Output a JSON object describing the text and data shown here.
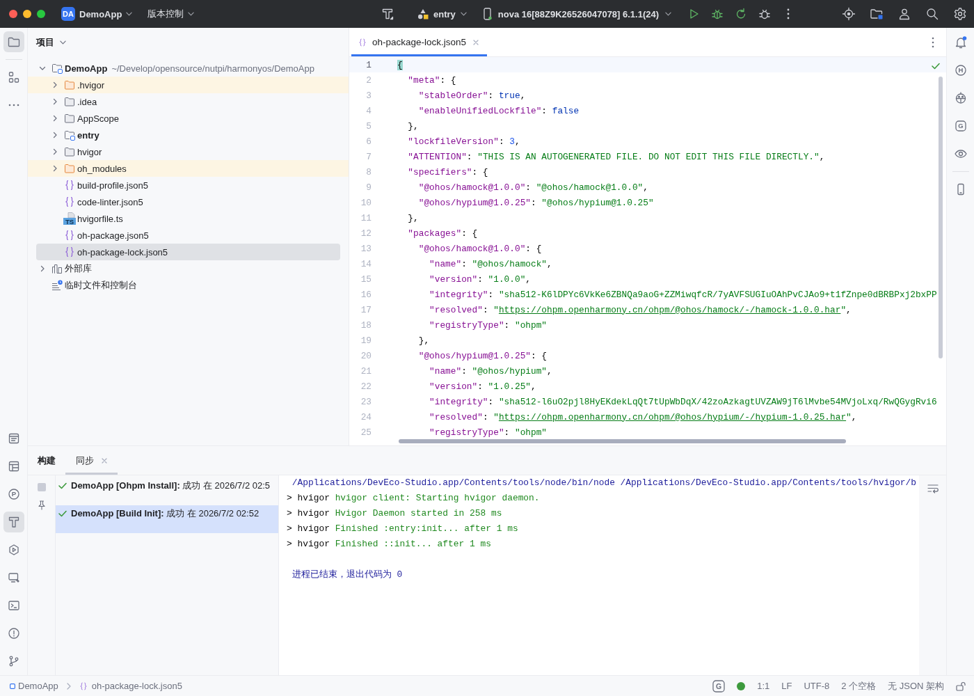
{
  "title_bar": {
    "project_badge": "DA",
    "project": "DemoApp",
    "vcs": "版本控制",
    "run_config": "entry",
    "device": "nova 16[88Z9K26526047078] 6.1.1(24)"
  },
  "left_toolbar": {
    "top": [
      {
        "selected": true
      },
      {
        "selected": false
      },
      {
        "selected": false
      }
    ],
    "bottom": [
      {
        "selected": false
      },
      {
        "selected": false
      },
      {
        "selected": false,
        "letter": "P"
      },
      {
        "selected": true
      },
      {
        "selected": false
      },
      {
        "selected": false
      },
      {
        "selected": false
      },
      {
        "selected": false
      },
      {
        "selected": false
      }
    ]
  },
  "project": {
    "title": "项目",
    "tree": [
      {
        "name": "DemoApp",
        "kind": "module",
        "path": "~/Develop/opensource/nutpi/harmonyos/DemoApp",
        "expanded": true,
        "selected": false,
        "children": [
          {
            "name": ".hvigor",
            "kind": "folder",
            "excluded": true,
            "expanded": false,
            "selected": false
          },
          {
            "name": ".idea",
            "kind": "folder",
            "excluded": false,
            "expanded": false,
            "selected": false
          },
          {
            "name": "AppScope",
            "kind": "folder",
            "excluded": false,
            "expanded": false,
            "selected": false
          },
          {
            "name": "entry",
            "kind": "module",
            "expanded": false,
            "selected": false
          },
          {
            "name": "hvigor",
            "kind": "folder",
            "excluded": false,
            "expanded": false,
            "selected": false
          },
          {
            "name": "oh_modules",
            "kind": "folder",
            "excluded": true,
            "expanded": false,
            "selected": false
          },
          {
            "name": "build-profile.json5",
            "kind": "json",
            "selected": false
          },
          {
            "name": "code-linter.json5",
            "kind": "json",
            "selected": false
          },
          {
            "name": "hvigorfile.ts",
            "kind": "ts",
            "icon_text": "TS",
            "selected": false
          },
          {
            "name": "oh-package.json5",
            "kind": "json",
            "selected": false
          },
          {
            "name": "oh-package-lock.json5",
            "kind": "json",
            "selected": true
          }
        ]
      },
      {
        "name": "外部库",
        "kind": "libraries",
        "expanded": false,
        "selected": false
      },
      {
        "name": "临时文件和控制台",
        "kind": "scratches",
        "selected": false
      }
    ]
  },
  "editor": {
    "tabs": [
      {
        "label": "oh-package-lock.json5",
        "selected": true
      }
    ],
    "lines": [
      {
        "number": "1",
        "current": true,
        "tokens": [
          {
            "kind": "match",
            "text": "{"
          }
        ]
      },
      {
        "number": "2",
        "current": false,
        "tokens": [
          {
            "kind": "key",
            "text": "  \"meta\""
          },
          {
            "kind": "punct",
            "text": ": {"
          }
        ]
      },
      {
        "number": "3",
        "current": false,
        "tokens": [
          {
            "kind": "key",
            "text": "    \"stableOrder\""
          },
          {
            "kind": "punct",
            "text": ": "
          },
          {
            "kind": "keyword",
            "text": "true"
          },
          {
            "kind": "punct",
            "text": ","
          }
        ]
      },
      {
        "number": "4",
        "current": false,
        "tokens": [
          {
            "kind": "key",
            "text": "    \"enableUnifiedLockfile\""
          },
          {
            "kind": "punct",
            "text": ": "
          },
          {
            "kind": "keyword",
            "text": "false"
          }
        ]
      },
      {
        "number": "5",
        "current": false,
        "tokens": [
          {
            "kind": "punct",
            "text": "  },"
          }
        ]
      },
      {
        "number": "6",
        "current": false,
        "tokens": [
          {
            "kind": "key",
            "text": "  \"lockfileVersion\""
          },
          {
            "kind": "punct",
            "text": ": "
          },
          {
            "kind": "number",
            "text": "3"
          },
          {
            "kind": "punct",
            "text": ","
          }
        ]
      },
      {
        "number": "7",
        "current": false,
        "tokens": [
          {
            "kind": "key",
            "text": "  \"ATTENTION\""
          },
          {
            "kind": "punct",
            "text": ": "
          },
          {
            "kind": "string",
            "text": "\"THIS IS AN AUTOGENERATED FILE. DO NOT EDIT THIS FILE DIRECTLY.\""
          },
          {
            "kind": "punct",
            "text": ","
          }
        ]
      },
      {
        "number": "8",
        "current": false,
        "tokens": [
          {
            "kind": "key",
            "text": "  \"specifiers\""
          },
          {
            "kind": "punct",
            "text": ": {"
          }
        ]
      },
      {
        "number": "9",
        "current": false,
        "tokens": [
          {
            "kind": "key",
            "text": "    \"@ohos/hamock@1.0.0\""
          },
          {
            "kind": "punct",
            "text": ": "
          },
          {
            "kind": "string",
            "text": "\"@ohos/hamock@1.0.0\""
          },
          {
            "kind": "punct",
            "text": ","
          }
        ]
      },
      {
        "number": "10",
        "current": false,
        "tokens": [
          {
            "kind": "key",
            "text": "    \"@ohos/hypium@1.0.25\""
          },
          {
            "kind": "punct",
            "text": ": "
          },
          {
            "kind": "string",
            "text": "\"@ohos/hypium@1.0.25\""
          }
        ]
      },
      {
        "number": "11",
        "current": false,
        "tokens": [
          {
            "kind": "punct",
            "text": "  },"
          }
        ]
      },
      {
        "number": "12",
        "current": false,
        "tokens": [
          {
            "kind": "key",
            "text": "  \"packages\""
          },
          {
            "kind": "punct",
            "text": ": {"
          }
        ]
      },
      {
        "number": "13",
        "current": false,
        "tokens": [
          {
            "kind": "key",
            "text": "    \"@ohos/hamock@1.0.0\""
          },
          {
            "kind": "punct",
            "text": ": {"
          }
        ]
      },
      {
        "number": "14",
        "current": false,
        "tokens": [
          {
            "kind": "key",
            "text": "      \"name\""
          },
          {
            "kind": "punct",
            "text": ": "
          },
          {
            "kind": "string",
            "text": "\"@ohos/hamock\""
          },
          {
            "kind": "punct",
            "text": ","
          }
        ]
      },
      {
        "number": "15",
        "current": false,
        "tokens": [
          {
            "kind": "key",
            "text": "      \"version\""
          },
          {
            "kind": "punct",
            "text": ": "
          },
          {
            "kind": "string",
            "text": "\"1.0.0\""
          },
          {
            "kind": "punct",
            "text": ","
          }
        ]
      },
      {
        "number": "16",
        "current": false,
        "tokens": [
          {
            "kind": "key",
            "text": "      \"integrity\""
          },
          {
            "kind": "punct",
            "text": ": "
          },
          {
            "kind": "string",
            "text": "\"sha512-K6lDPYc6VkKe6ZBNQa9aoG+ZZMiwqfcR/7yAVFSUGIuOAhPvCJAo9+t1fZnpe0dBRBPxj2bxPP"
          }
        ]
      },
      {
        "number": "17",
        "current": false,
        "tokens": [
          {
            "kind": "key",
            "text": "      \"resolved\""
          },
          {
            "kind": "punct",
            "text": ": "
          },
          {
            "kind": "string",
            "text": "\""
          },
          {
            "kind": "link",
            "text": "https://ohpm.openharmony.cn/ohpm/@ohos/hamock/-/hamock-1.0.0.har"
          },
          {
            "kind": "string",
            "text": "\""
          },
          {
            "kind": "punct",
            "text": ","
          }
        ]
      },
      {
        "number": "18",
        "current": false,
        "tokens": [
          {
            "kind": "key",
            "text": "      \"registryType\""
          },
          {
            "kind": "punct",
            "text": ": "
          },
          {
            "kind": "string",
            "text": "\"ohpm\""
          }
        ]
      },
      {
        "number": "19",
        "current": false,
        "tokens": [
          {
            "kind": "punct",
            "text": "    },"
          }
        ]
      },
      {
        "number": "20",
        "current": false,
        "tokens": [
          {
            "kind": "key",
            "text": "    \"@ohos/hypium@1.0.25\""
          },
          {
            "kind": "punct",
            "text": ": {"
          }
        ]
      },
      {
        "number": "21",
        "current": false,
        "tokens": [
          {
            "kind": "key",
            "text": "      \"name\""
          },
          {
            "kind": "punct",
            "text": ": "
          },
          {
            "kind": "string",
            "text": "\"@ohos/hypium\""
          },
          {
            "kind": "punct",
            "text": ","
          }
        ]
      },
      {
        "number": "22",
        "current": false,
        "tokens": [
          {
            "kind": "key",
            "text": "      \"version\""
          },
          {
            "kind": "punct",
            "text": ": "
          },
          {
            "kind": "string",
            "text": "\"1.0.25\""
          },
          {
            "kind": "punct",
            "text": ","
          }
        ]
      },
      {
        "number": "23",
        "current": false,
        "tokens": [
          {
            "kind": "key",
            "text": "      \"integrity\""
          },
          {
            "kind": "punct",
            "text": ": "
          },
          {
            "kind": "string",
            "text": "\"sha512-l6uO2pjl8HyEKdekLqQt7tUpWbDqX/42zoAzkagtUVZAW9jT6lMvbe54MVjoLxq/RwQGygRvi6"
          }
        ]
      },
      {
        "number": "24",
        "current": false,
        "tokens": [
          {
            "kind": "key",
            "text": "      \"resolved\""
          },
          {
            "kind": "punct",
            "text": ": "
          },
          {
            "kind": "string",
            "text": "\""
          },
          {
            "kind": "link",
            "text": "https://ohpm.openharmony.cn/ohpm/@ohos/hypium/-/hypium-1.0.25.har"
          },
          {
            "kind": "string",
            "text": "\""
          },
          {
            "kind": "punct",
            "text": ","
          }
        ]
      },
      {
        "number": "25",
        "current": false,
        "tokens": [
          {
            "kind": "key",
            "text": "      \"registryType\""
          },
          {
            "kind": "punct",
            "text": ": "
          },
          {
            "kind": "string",
            "text": "\"ohpm\""
          }
        ]
      }
    ]
  },
  "right_toolbar": {
    "notification_unread": true,
    "letters": [
      "H",
      "G"
    ]
  },
  "build_panel": {
    "title": "构建",
    "tabs": [
      {
        "label": "同步",
        "selected": true
      }
    ],
    "tasks": [
      {
        "success": true,
        "text": "**DemoApp [Ohpm Install]:** 成功 在 2026/7/2 02:5",
        "selected": false
      },
      {
        "success": true,
        "text": "**DemoApp [Build Init]:** 成功 在 2026/7/2 02:52",
        "selected": true
      }
    ],
    "console": [
      {
        "kind": "command",
        "text": "/Applications/DevEco-Studio.app/Contents/tools/node/bin/node /Applications/DevEco-Studio.app/Contents/tools/hvigor/b"
      },
      {
        "kind": "log",
        "prefix": "> hvigor",
        "text": "hvigor client: Starting hvigor daemon."
      },
      {
        "kind": "log",
        "prefix": "> hvigor",
        "text": "Hvigor Daemon started in 258 ms"
      },
      {
        "kind": "log",
        "prefix": "> hvigor",
        "text": "Finished :entry:init... after 1 ms"
      },
      {
        "kind": "log",
        "prefix": "> hvigor",
        "text": "Finished ::init... after 1 ms"
      },
      {
        "kind": "exit",
        "text": "进程已结束，退出代码为 0"
      }
    ]
  },
  "status_bar": {
    "breadcrumbs": [
      {
        "kind": "module",
        "label": "DemoApp"
      },
      {
        "kind": "json",
        "label": "oh-package-lock.json5"
      }
    ],
    "widget_letter": "G",
    "items": [
      "1:1",
      "LF",
      "UTF-8",
      "2 个空格",
      "无 JSON 架构"
    ]
  }
}
